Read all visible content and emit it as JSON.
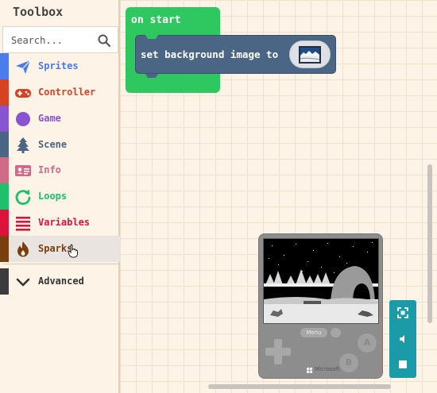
{
  "toolbox": {
    "title": "Toolbox",
    "search_placeholder": "Search...",
    "categories": [
      {
        "label": "Sprites",
        "color": "#4b7bec",
        "icon": "paper-plane-icon"
      },
      {
        "label": "Controller",
        "color": "#d54322",
        "icon": "gamepad-icon"
      },
      {
        "label": "Game",
        "color": "#8854d0",
        "icon": "circle-icon"
      },
      {
        "label": "Scene",
        "color": "#4b6584",
        "icon": "tree-icon"
      },
      {
        "label": "Info",
        "color": "#cf6a87",
        "icon": "id-card-icon"
      },
      {
        "label": "Loops",
        "color": "#20bf6b",
        "icon": "refresh-icon"
      },
      {
        "label": "Variables",
        "color": "#dc143c",
        "icon": "list-icon"
      },
      {
        "label": "Sparks",
        "color": "#7a3f10",
        "icon": "flame-icon"
      },
      {
        "label": "Advanced",
        "color": "#3c3c3c",
        "icon": "chevron-down-icon"
      }
    ]
  },
  "workspace": {
    "on_start_label": "on start",
    "set_background_label": "set background image to"
  },
  "simulator": {
    "menu_label": "Menu",
    "a_label": "A",
    "b_label": "B",
    "brand_label": "Microsoft"
  }
}
